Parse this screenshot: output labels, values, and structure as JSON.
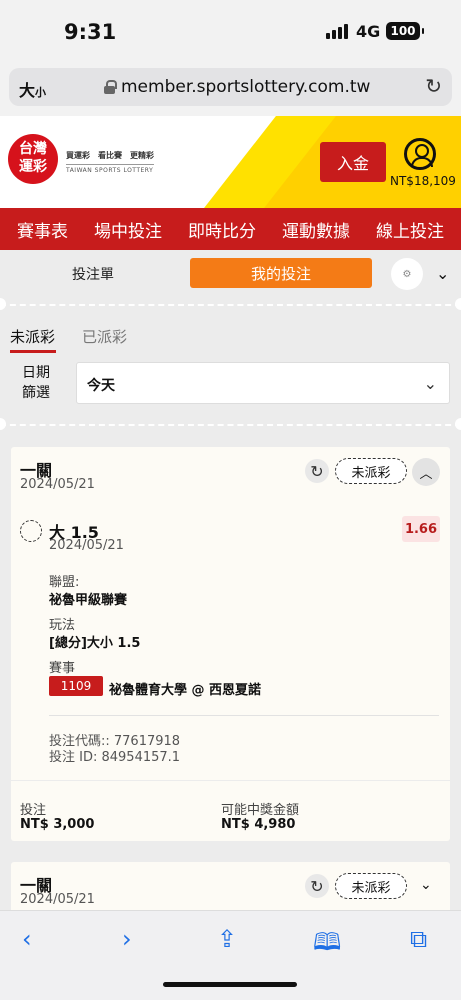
{
  "status_bar": {
    "time": "9:31",
    "network": "4G",
    "battery": "100"
  },
  "browser": {
    "text_size": "大",
    "text_size_small": "小",
    "url": "member.sportslottery.com.tw",
    "reload_icon": "reload-icon"
  },
  "header": {
    "logo_line1": "台灣",
    "logo_line2": "運彩",
    "slogan": "買運彩　看比賽　更精彩",
    "brand_en": "TAIWAN SPORTS LOTTERY",
    "deposit_label": "入金",
    "balance": "NT$18,109"
  },
  "nav": {
    "items": [
      "賽事表",
      "場中投注",
      "即時比分",
      "運動數據",
      "線上投注"
    ]
  },
  "tabs": {
    "bet_slip": "投注單",
    "my_bets": "我的投注"
  },
  "status_tabs": {
    "unsettled": "未派彩",
    "settled": "已派彩"
  },
  "date_filter": {
    "label_line1": "日期",
    "label_line2": "篩選",
    "value": "今天"
  },
  "bets": [
    {
      "type": "一關",
      "date": "2024/05/21",
      "status": "未派彩",
      "selection": "大 1.5",
      "selection_date": "2024/05/21",
      "odds": "1.66",
      "league_label": "聯盟:",
      "league": "祕魯甲級聯賽",
      "market_label": "玩法",
      "market": "[總分]大小 1.5",
      "event_label": "賽事",
      "match_id": "1109",
      "match": "祕魯體育大學 @ 西恩夏諾",
      "bet_code": "投注代碼:: 77617918",
      "bet_id": "投注 ID: 84954157.1",
      "stake_label": "投注",
      "stake": "NT$ 3,000",
      "win_label": "可能中獎金額",
      "win": "NT$ 4,980"
    },
    {
      "type": "一關",
      "date": "2024/05/21",
      "status": "未派彩"
    }
  ]
}
